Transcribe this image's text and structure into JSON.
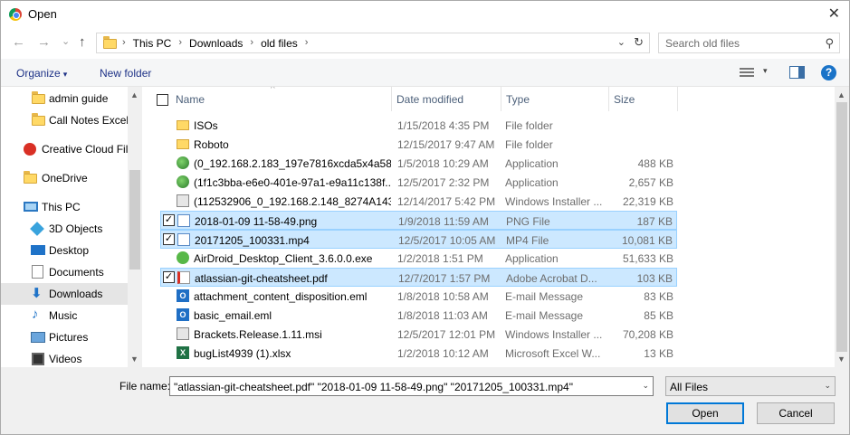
{
  "window": {
    "title": "Open",
    "close_glyph": "✕",
    "app_icon": "chrome-icon"
  },
  "nav": {
    "back_glyph": "←",
    "forward_glyph": "→",
    "recent_glyph": "⌄",
    "up_glyph": "↑",
    "breadcrumbs": [
      "This PC",
      "Downloads",
      "old files"
    ],
    "separator": "›",
    "refresh_glyph": "↻",
    "dropdown_glyph": "⌄",
    "search_placeholder": "Search old files",
    "search_glyph": "⚲"
  },
  "toolbar": {
    "organize": "Organize",
    "organize_arrow": "▾",
    "new_folder": "New folder",
    "view_arrow": "▾",
    "help": "?"
  },
  "sidebar": {
    "items": [
      {
        "label": "admin guide",
        "icon": "folder-icon"
      },
      {
        "label": "Call Notes Excel",
        "icon": "folder-icon"
      },
      {
        "label": "Creative Cloud Fil",
        "icon": "creative-cloud-icon"
      },
      {
        "label": "OneDrive",
        "icon": "onedrive-icon"
      },
      {
        "label": "This PC",
        "icon": "this-pc-icon"
      },
      {
        "label": "3D Objects",
        "icon": "3d-objects-icon"
      },
      {
        "label": "Desktop",
        "icon": "desktop-icon"
      },
      {
        "label": "Documents",
        "icon": "documents-icon"
      },
      {
        "label": "Downloads",
        "icon": "downloads-icon",
        "selected": true
      },
      {
        "label": "Music",
        "icon": "music-icon"
      },
      {
        "label": "Pictures",
        "icon": "pictures-icon"
      },
      {
        "label": "Videos",
        "icon": "videos-icon"
      }
    ],
    "scroll_up": "▲",
    "scroll_down": "▼"
  },
  "list": {
    "columns": {
      "name": "Name",
      "date": "Date modified",
      "type": "Type",
      "size": "Size"
    },
    "sort_caret": "^",
    "rows": [
      {
        "name": "ISOs",
        "date": "1/15/2018 4:35 PM",
        "type": "File folder",
        "size": "",
        "icon": "folder-icon",
        "selected": false
      },
      {
        "name": "Roboto",
        "date": "12/15/2017 9:47 AM",
        "type": "File folder",
        "size": "",
        "icon": "folder-icon",
        "selected": false
      },
      {
        "name": "(0_192.168.2.183_197e7816xcda5x4a58x...",
        "date": "1/5/2018 10:29 AM",
        "type": "Application",
        "size": "488 KB",
        "icon": "application-icon",
        "selected": false
      },
      {
        "name": "(1f1c3bba-e6e0-401e-97a1-e9a11c138f...",
        "date": "12/5/2017 2:32 PM",
        "type": "Application",
        "size": "2,657 KB",
        "icon": "application-icon",
        "selected": false
      },
      {
        "name": "(112532906_0_192.168.2.148_8274A143...",
        "date": "12/14/2017 5:42 PM",
        "type": "Windows Installer ...",
        "size": "22,319 KB",
        "icon": "installer-icon",
        "selected": false
      },
      {
        "name": "2018-01-09 11-58-49.png",
        "date": "1/9/2018 11:59 AM",
        "type": "PNG File",
        "size": "187 KB",
        "icon": "png-file-icon",
        "selected": true
      },
      {
        "name": "20171205_100331.mp4",
        "date": "12/5/2017 10:05 AM",
        "type": "MP4 File",
        "size": "10,081 KB",
        "icon": "mp4-file-icon",
        "selected": true
      },
      {
        "name": "AirDroid_Desktop_Client_3.6.0.0.exe",
        "date": "1/2/2018 1:51 PM",
        "type": "Application",
        "size": "51,633 KB",
        "icon": "airdroid-icon",
        "selected": false
      },
      {
        "name": "atlassian-git-cheatsheet.pdf",
        "date": "12/7/2017 1:57 PM",
        "type": "Adobe Acrobat D...",
        "size": "103 KB",
        "icon": "pdf-file-icon",
        "selected": true
      },
      {
        "name": "attachment_content_disposition.eml",
        "date": "1/8/2018 10:58 AM",
        "type": "E-mail Message",
        "size": "83 KB",
        "icon": "email-file-icon",
        "selected": false
      },
      {
        "name": "basic_email.eml",
        "date": "1/8/2018 11:03 AM",
        "type": "E-mail Message",
        "size": "85 KB",
        "icon": "email-file-icon",
        "selected": false
      },
      {
        "name": "Brackets.Release.1.11.msi",
        "date": "12/5/2017 12:01 PM",
        "type": "Windows Installer ...",
        "size": "70,208 KB",
        "icon": "installer-icon",
        "selected": false
      },
      {
        "name": "bugList4939 (1).xlsx",
        "date": "1/2/2018 10:12 AM",
        "type": "Microsoft Excel W...",
        "size": "13 KB",
        "icon": "excel-file-icon",
        "selected": false
      }
    ],
    "check_glyph": "✓"
  },
  "footer": {
    "file_name_label": "File name:",
    "file_name_value": "\"atlassian-git-cheatsheet.pdf\" \"2018-01-09 11-58-49.png\" \"20171205_100331.mp4\"",
    "file_name_dropdown": "⌄",
    "file_type_value": "All Files",
    "file_type_dropdown": "⌄",
    "open_label": "Open",
    "cancel_label": "Cancel"
  },
  "colors": {
    "selection_bg": "#cce8ff",
    "selection_border": "#99d1ff",
    "link_blue": "#1e3287",
    "accent": "#0078d7"
  }
}
